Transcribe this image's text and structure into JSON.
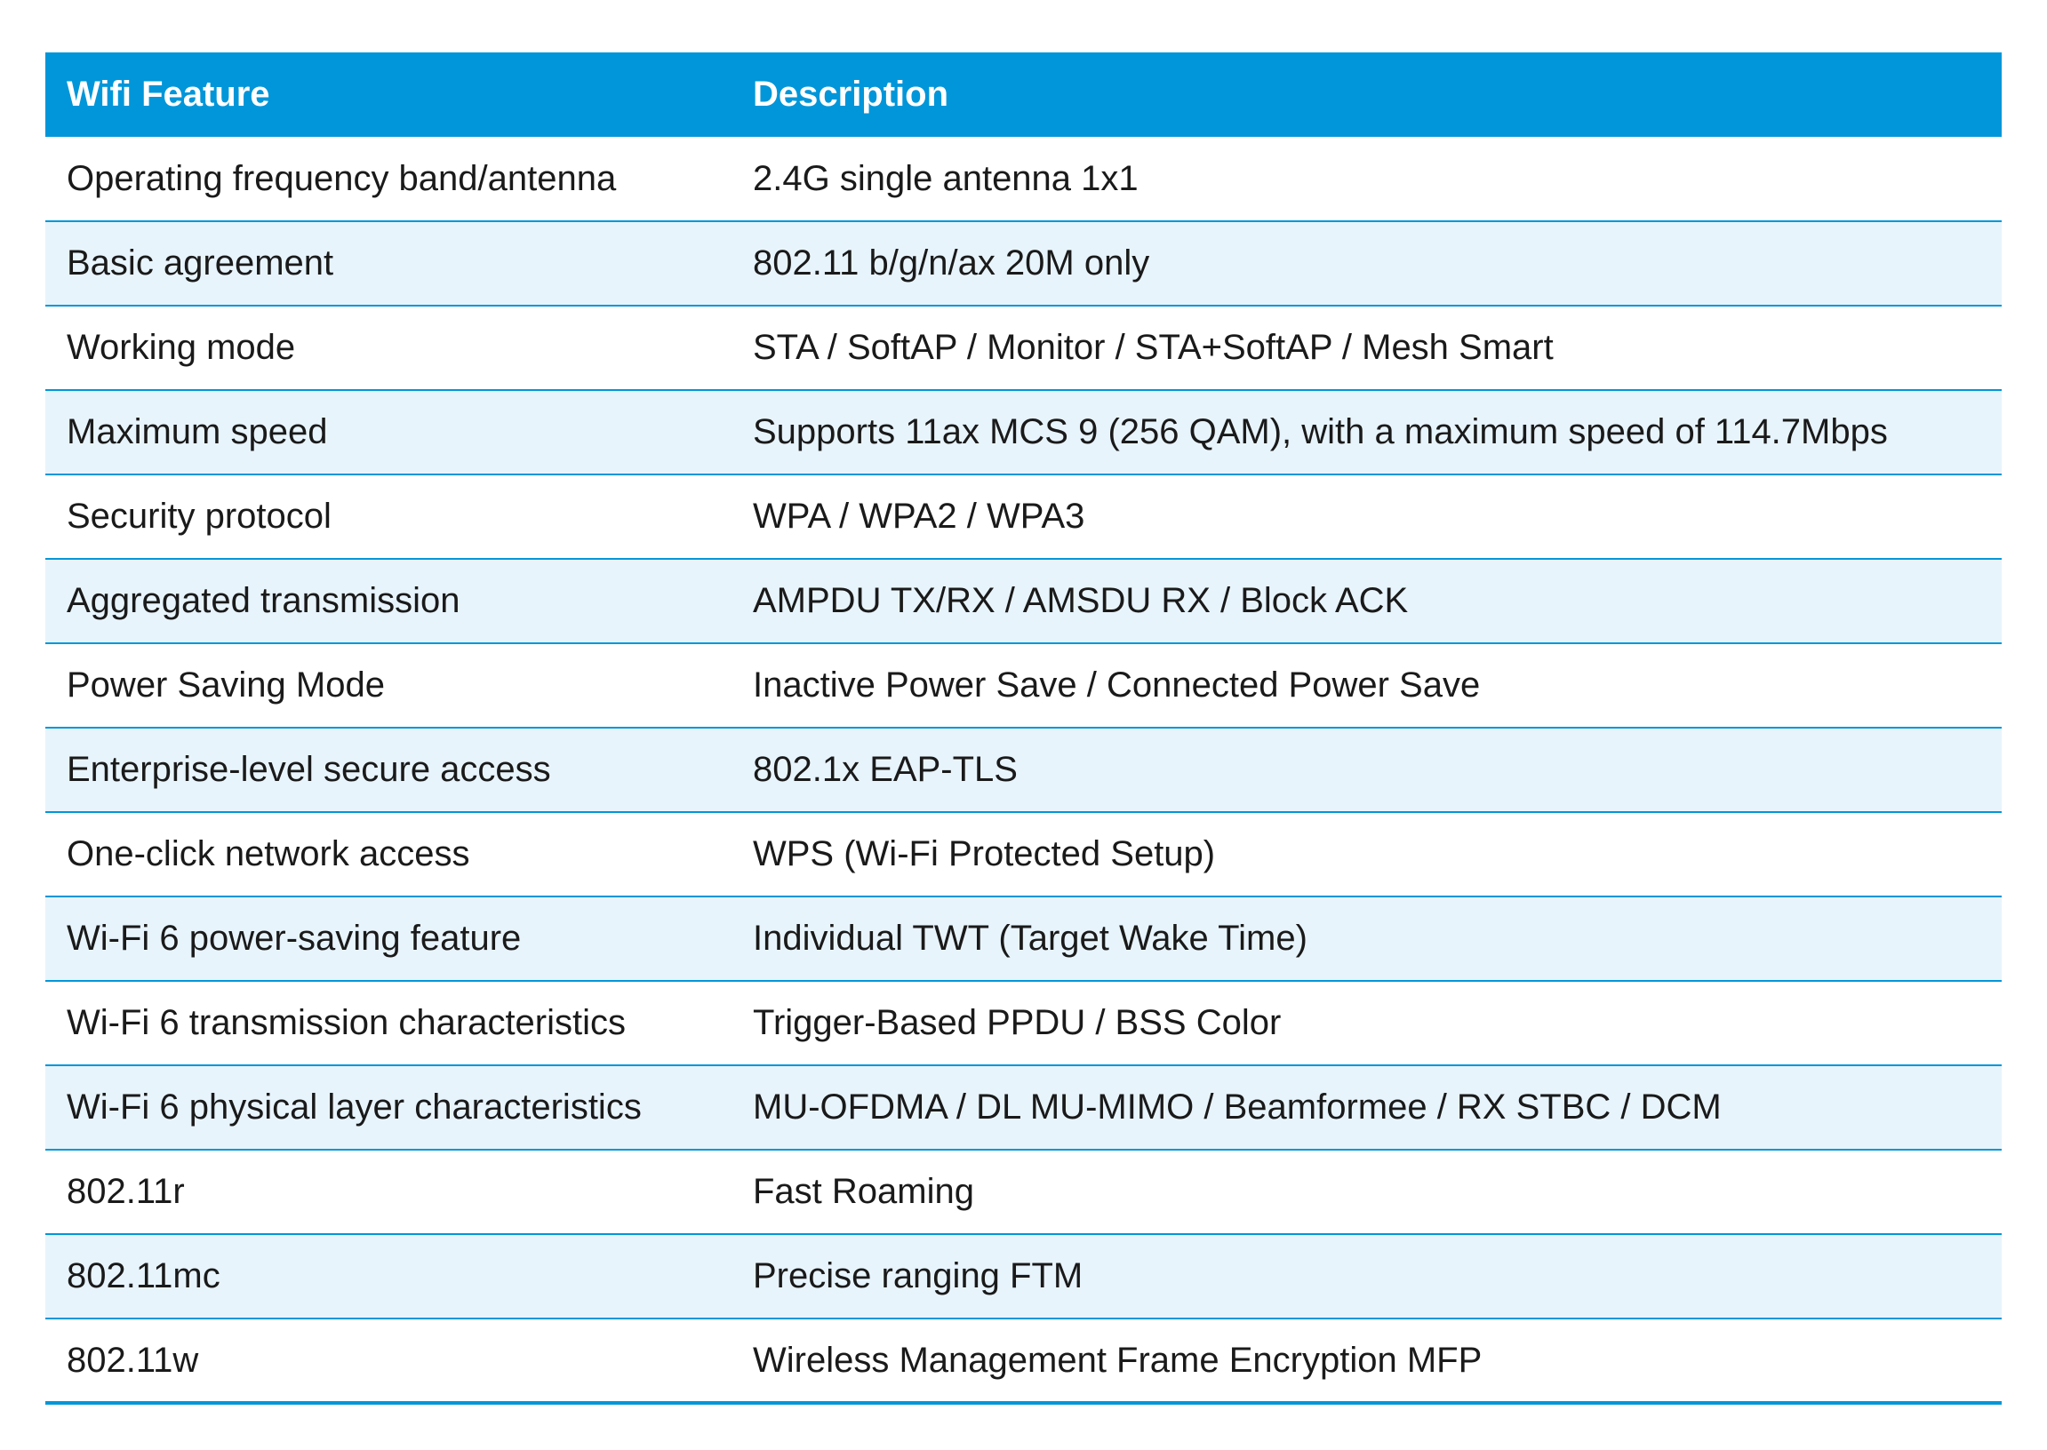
{
  "table": {
    "headers": [
      "Wifi Feature",
      "Description"
    ],
    "rows": [
      {
        "feature": "Operating frequency band/antenna",
        "description": "2.4G single antenna 1x1"
      },
      {
        "feature": "Basic agreement",
        "description": "802.11 b/g/n/ax 20M only"
      },
      {
        "feature": "Working mode",
        "description": "STA / SoftAP / Monitor / STA+SoftAP / Mesh Smart"
      },
      {
        "feature": "Maximum speed",
        "description": "Supports 11ax MCS 9 (256 QAM), with a maximum speed of 114.7Mbps"
      },
      {
        "feature": "Security protocol",
        "description": "WPA / WPA2 / WPA3"
      },
      {
        "feature": "Aggregated transmission",
        "description": "AMPDU TX/RX / AMSDU RX / Block ACK"
      },
      {
        "feature": "Power Saving Mode",
        "description": "Inactive Power Save / Connected Power Save"
      },
      {
        "feature": "Enterprise-level secure access",
        "description": "802.1x EAP-TLS"
      },
      {
        "feature": "One-click network access",
        "description": "WPS (Wi-Fi Protected Setup)"
      },
      {
        "feature": "Wi-Fi 6 power-saving feature",
        "description": "Individual TWT (Target Wake Time)"
      },
      {
        "feature": "Wi-Fi 6 transmission characteristics",
        "description": "Trigger-Based PPDU / BSS Color"
      },
      {
        "feature": "Wi-Fi 6 physical layer characteristics",
        "description": "MU-OFDMA / DL MU-MIMO / Beamformee / RX STBC / DCM"
      },
      {
        "feature": "802.11r",
        "description": "Fast Roaming"
      },
      {
        "feature": "802.11mc",
        "description": "Precise ranging FTM"
      },
      {
        "feature": "802.11w",
        "description": "Wireless Management Frame Encryption MFP"
      }
    ]
  },
  "colors": {
    "header_bg": "#0096d9",
    "header_text": "#ffffff",
    "stripe_bg": "#e8f4fc",
    "rule": "#0096d9"
  }
}
